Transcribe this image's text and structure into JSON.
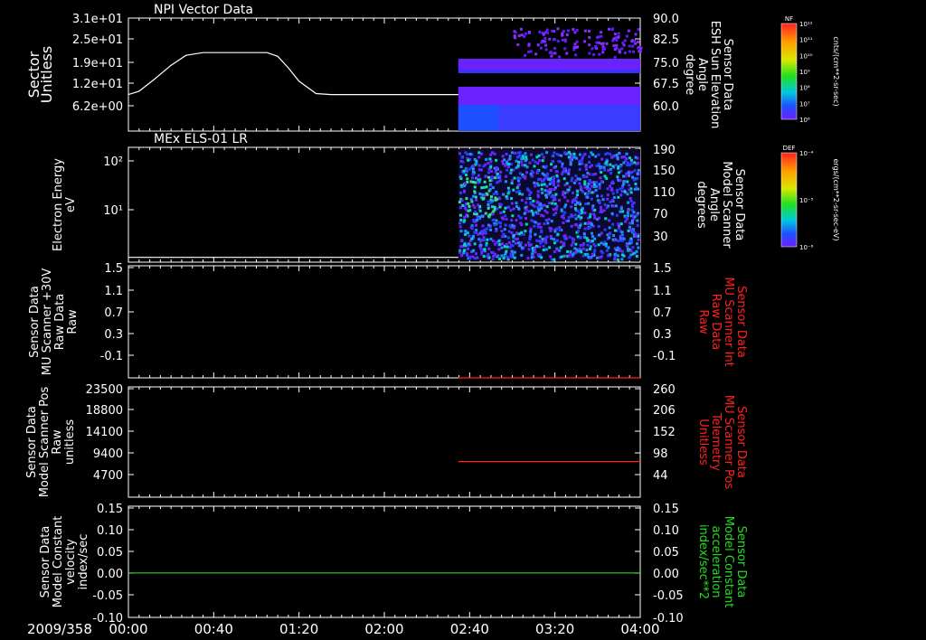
{
  "time_axis": {
    "date": "2009/358",
    "tick_labels": [
      "00:00",
      "00:40",
      "01:20",
      "02:00",
      "02:40",
      "03:20",
      "04:00"
    ],
    "tick_minutes": [
      0,
      40,
      80,
      120,
      160,
      200,
      240
    ],
    "range_minutes": [
      0,
      240
    ]
  },
  "colors": {
    "background": "#000000",
    "frame": "#ffffff",
    "red": "#ff2020",
    "green": "#22dd22",
    "purple": "#7a22ff",
    "blue": "#2a3cff"
  },
  "panels": [
    {
      "id": "npi",
      "title": "NPI Vector Data",
      "left_label": [
        "Sector",
        "Unitless"
      ],
      "left_ticks": [
        "3.1e+01",
        "2.5e+01",
        "1.9e+01",
        "1.2e+01",
        "6.2e+00"
      ],
      "right_label": [
        "Sensor Data",
        "ESH Sun Elevation",
        "Angle",
        "degree"
      ],
      "right_label_color": "#ffffff",
      "right_ticks": [
        "90.0",
        "82.5",
        "75.0",
        "67.5",
        "60.0"
      ],
      "colorbar": {
        "label": "NF",
        "unit": "cnts/(cm**2-sr-sec)",
        "ticks": [
          "10¹²",
          "10¹¹",
          "10¹⁰",
          "10⁹",
          "10⁸",
          "10⁷",
          "10⁶"
        ]
      }
    },
    {
      "id": "els",
      "title": "MEx ELS-01 LR",
      "left_label": [
        "Electron Energy",
        "eV"
      ],
      "left_ticks": [
        "10²",
        "10¹"
      ],
      "right_label": [
        "Sensor Data",
        "Model Scanner",
        "Angle",
        "degrees"
      ],
      "right_label_color": "#ffffff",
      "right_ticks": [
        "190",
        "150",
        "110",
        "70",
        "30"
      ],
      "colorbar": {
        "label": "DEF",
        "unit": "ergs/(cm**2-sr-sec-eV)",
        "ticks": [
          "10⁻⁴",
          "10⁻⁵",
          "10⁻⁶"
        ]
      }
    },
    {
      "id": "mu_raw",
      "title": "",
      "left_label": [
        "Sensor Data",
        "MU Scanner +30V",
        "Raw Data",
        "Raw"
      ],
      "left_ticks": [
        "1.5",
        "1.1",
        "0.7",
        "0.3",
        "-0.1"
      ],
      "right_label": [
        "Sensor Data",
        "MU Scanner Int",
        "Raw Data",
        "Raw"
      ],
      "right_label_color": "#ff2020",
      "right_ticks": [
        "1.5",
        "1.1",
        "0.7",
        "0.3",
        "-0.1"
      ]
    },
    {
      "id": "mu_pos",
      "title": "",
      "left_label": [
        "Sensor Data",
        "Model Scanner Pos",
        "Raw",
        "unitless"
      ],
      "left_ticks": [
        "23500",
        "18800",
        "14100",
        "9400",
        "4700"
      ],
      "right_label": [
        "Sensor Data",
        "MU Scanner Pos",
        "Telemetry",
        "Unitless"
      ],
      "right_label_color": "#ff2020",
      "right_ticks": [
        "260",
        "206",
        "152",
        "98",
        "44"
      ]
    },
    {
      "id": "velocity",
      "title": "",
      "left_label": [
        "Sensor Data",
        "Model Constant",
        "velocity",
        "index/sec"
      ],
      "left_ticks": [
        "0.15",
        "0.10",
        "0.05",
        "0.00",
        "-0.05",
        "-0.10"
      ],
      "right_label": [
        "Sensor Data",
        "Model Constant",
        "acceleration",
        "index/sec**2"
      ],
      "right_label_color": "#22dd22",
      "right_ticks": [
        "0.15",
        "0.10",
        "0.05",
        "0.00",
        "-0.05",
        "-0.10"
      ]
    }
  ],
  "chart_data": [
    {
      "type": "line",
      "panel": "npi",
      "series_name": "ESH Sun Elevation Angle",
      "y_unit": "degree",
      "ylim": [
        56.0,
        90.0
      ],
      "x_minutes": [
        0,
        5,
        12,
        20,
        27,
        35,
        45,
        55,
        65,
        70,
        75,
        80,
        88,
        95,
        105,
        120,
        140,
        160,
        180,
        200,
        220,
        232,
        236,
        238,
        240
      ],
      "y": [
        67.0,
        68.0,
        71.5,
        75.8,
        78.8,
        79.6,
        79.6,
        79.6,
        79.6,
        78.5,
        75.0,
        71.0,
        67.3,
        67.0,
        67.0,
        67.0,
        67.0,
        67.0,
        67.0,
        67.0,
        67.0,
        67.0,
        66.2,
        62.5,
        57.5
      ],
      "spectrogram_coverage_minutes": [
        154.7,
        240
      ]
    },
    {
      "type": "line",
      "panel": "els",
      "series_name": "Model Scanner Angle",
      "y_unit": "degrees",
      "ylim": [
        0,
        190
      ],
      "x_minutes": [
        0,
        240
      ],
      "y": [
        8,
        8
      ],
      "spectrogram_coverage_minutes": [
        154.7,
        240
      ]
    },
    {
      "type": "line",
      "panel": "mu_raw",
      "series_name": "MU Scanner Int Raw Data",
      "ylim": [
        -0.1,
        1.5
      ],
      "x_minutes": [
        154.7,
        240
      ],
      "y": [
        -0.1,
        -0.1
      ]
    },
    {
      "type": "line",
      "panel": "mu_pos",
      "series_name": "MU Scanner Pos Telemetry",
      "ylim": [
        0,
        260
      ],
      "x_minutes": [
        154.7,
        240
      ],
      "y": [
        84,
        84
      ]
    },
    {
      "type": "line",
      "panel": "velocity",
      "series_name": "Model Constant velocity",
      "ylim": [
        -0.1,
        0.15
      ],
      "x_minutes": [
        0,
        240
      ],
      "y": [
        0.0,
        0.0
      ]
    }
  ]
}
